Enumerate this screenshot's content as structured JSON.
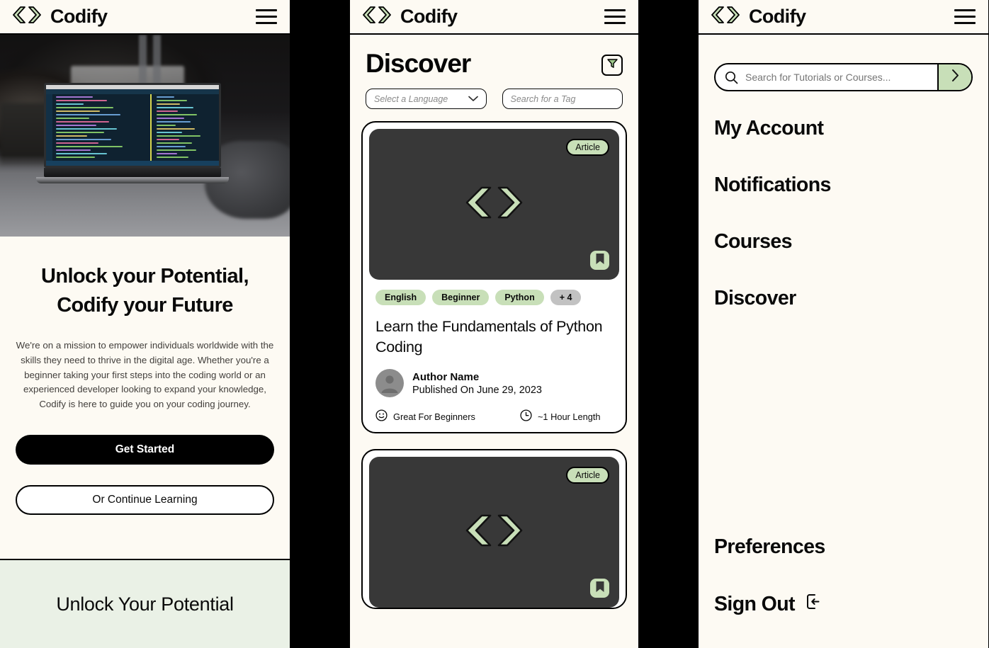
{
  "app": {
    "brand": "Codify",
    "logo_icon": "code-chevrons-icon",
    "menu_icon": "hamburger-icon",
    "accent_green": "#c8dfb8",
    "section_green": "#eaf1e6",
    "background": "#fdfaf3",
    "thumb_dark": "#383838"
  },
  "landing": {
    "hero_image_alt": "laptop-with-code-editor-photo",
    "title_line_1": "Unlock your Potential,",
    "title_line_2": "Codify your Future",
    "description": "We're  on a mission to empower individuals worldwide with the skills they need to thrive in the digital age. Whether you're a beginner taking your first steps into the coding world or an experienced developer looking to expand your knowledge, Codify is here to guide you on your coding journey.",
    "primary_cta": "Get Started",
    "secondary_cta": "Or Continue Learning",
    "promo_heading": "Unlock Your Potential"
  },
  "discover": {
    "title": "Discover",
    "filter_icon": "funnel-filter-icon",
    "language_select": {
      "placeholder": "Select a Language",
      "chevron_icon": "chevron-down-icon"
    },
    "tag_search": {
      "placeholder": "Search for a Tag"
    },
    "cards": [
      {
        "badge": "Article",
        "thumb_icon": "code-chevrons-icon",
        "bookmark_icon": "bookmark-icon",
        "tags": [
          "English",
          "Beginner",
          "Python"
        ],
        "more_tags": "+ 4",
        "title": "Learn the Fundamentals of Python Coding",
        "author": "Author Name",
        "published": "Published On June 29, 2023",
        "difficulty_icon": "smiley-icon",
        "difficulty": "Great For Beginners",
        "duration_icon": "clock-icon",
        "duration": "~1 Hour Length"
      },
      {
        "badge": "Article",
        "thumb_icon": "code-chevrons-icon",
        "bookmark_icon": "bookmark-icon",
        "tags": [],
        "more_tags": "",
        "title": "",
        "author": "",
        "published": "",
        "difficulty_icon": "smiley-icon",
        "difficulty": "",
        "duration_icon": "clock-icon",
        "duration": ""
      }
    ]
  },
  "menu": {
    "search": {
      "icon": "search-icon",
      "placeholder": "Search for Tutorials or Courses...",
      "value": "",
      "submit_icon": "chevron-right-icon"
    },
    "items": [
      {
        "label": "My Account"
      },
      {
        "label": "Notifications"
      },
      {
        "label": "Courses"
      },
      {
        "label": "Discover"
      }
    ],
    "bottom_items": [
      {
        "label": "Preferences",
        "icon": ""
      },
      {
        "label": "Sign Out",
        "icon": "sign-out-icon"
      }
    ]
  }
}
